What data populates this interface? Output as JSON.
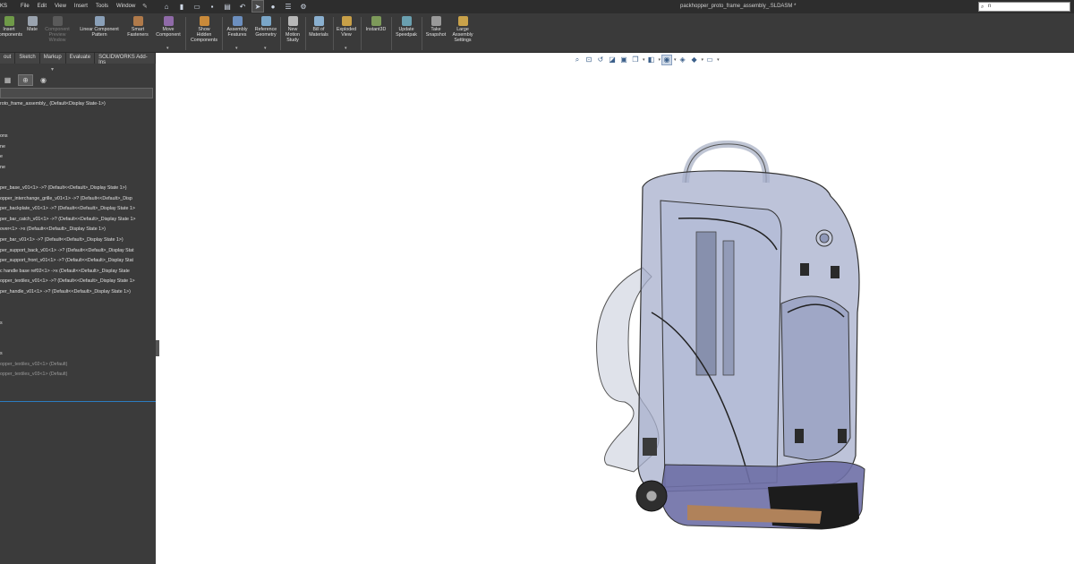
{
  "titlebar": {
    "brand": "KS",
    "menu": [
      "File",
      "Edit",
      "View",
      "Insert",
      "Tools",
      "Window"
    ],
    "document_title": "packhopper_proto_frame_assembly_.SLDASM *",
    "search_value": "n"
  },
  "quick_access": [
    "home-icon",
    "new-icon",
    "open-icon",
    "save-icon",
    "print-icon",
    "undo-icon",
    "select-icon",
    "rebuild-icon",
    "file-properties-icon",
    "options-icon"
  ],
  "ribbon": {
    "buttons": [
      {
        "label": "Insert\nComponents",
        "enabled": true
      },
      {
        "label": "Mate",
        "enabled": true
      },
      {
        "label": "Component\nPreview\nWindow",
        "enabled": false
      },
      {
        "label": "Linear Component\nPattern",
        "enabled": true
      },
      {
        "label": "Smart\nFasteners",
        "enabled": true
      },
      {
        "label": "Move\nComponent",
        "enabled": true
      },
      {
        "label": "Show\nHidden\nComponents",
        "enabled": true
      },
      {
        "label": "Assembly\nFeatures",
        "enabled": true
      },
      {
        "label": "Reference\nGeometry",
        "enabled": true
      },
      {
        "label": "New\nMotion\nStudy",
        "enabled": true
      },
      {
        "label": "Bill of\nMaterials",
        "enabled": true
      },
      {
        "label": "Exploded\nView",
        "enabled": true
      },
      {
        "label": "Instant3D",
        "enabled": true
      },
      {
        "label": "Update\nSpeedpak",
        "enabled": true
      },
      {
        "label": "Take\nSnapshot",
        "enabled": true
      },
      {
        "label": "Large\nAssembly\nSettings",
        "enabled": true
      }
    ]
  },
  "tabs": [
    "out",
    "Sketch",
    "Markup",
    "Evaluate",
    "SOLIDWORKS Add-Ins"
  ],
  "panel_tools": [
    "property-manager-icon",
    "configuration-manager-icon",
    "display-manager-icon"
  ],
  "tree": [
    {
      "label": "roto_frame_assembly_ (Default<Display State-1>)",
      "dim": false
    },
    {
      "label": "ons",
      "dim": false
    },
    {
      "label": "ne",
      "dim": false
    },
    {
      "label": "e",
      "dim": false
    },
    {
      "label": "ne",
      "dim": false
    },
    {
      "label": "per_base_v01<1> ->? (Default<<Default>_Display State 1>)",
      "dim": false
    },
    {
      "label": "opper_interchange_grille_v01<1> ->? (Default<<Default>_Disp",
      "dim": false
    },
    {
      "label": "per_backplate_v01<1> ->? (Default<<Default>_Display State 1>",
      "dim": false
    },
    {
      "label": "per_bar_catch_v01<1> ->? (Default<<Default>_Display State 1>",
      "dim": false
    },
    {
      "label": "over<1> ->x (Default<<Default>_Display State 1>)",
      "dim": false
    },
    {
      "label": "per_bar_v01<1> ->? (Default<<Default>_Display State 1>)",
      "dim": false
    },
    {
      "label": "per_support_back_v01<1> ->? (Default<<Default>_Display Stat",
      "dim": false
    },
    {
      "label": "per_support_front_v01<1> ->? (Default<<Default>_Display Stat",
      "dim": false
    },
    {
      "label": "c handle base ref02<1> ->x (Default<<Default>_Display State",
      "dim": false
    },
    {
      "label": "opper_textiles_v01<1> ->? (Default<<Default>_Display State 1>",
      "dim": false
    },
    {
      "label": "per_handle_v01<1> ->? (Default<<Default>_Display State 1>)",
      "dim": false
    },
    {
      "label": "s",
      "dim": false
    },
    {
      "label": "s",
      "dim": false
    },
    {
      "label": "opper_textiles_v02<1> (Default)",
      "dim": true
    },
    {
      "label": "opper_textiles_v03<1> (Default)",
      "dim": true
    }
  ],
  "hud_tools": [
    "zoom-to-fit-icon",
    "zoom-to-area-icon",
    "previous-view-icon",
    "section-view-icon",
    "dynamic-annotation-icon",
    "view-orientation-icon",
    "display-style-icon",
    "hide-show-items-icon",
    "edit-appearance-icon",
    "apply-scene-icon",
    "view-settings-icon"
  ],
  "colors": {
    "titlebar_bg": "#2d2d2d",
    "ribbon_bg": "#3a3a3a",
    "panel_bg": "#3b3b3b",
    "accent": "#2c7bbf",
    "graphics_bg": "#ffffff"
  }
}
